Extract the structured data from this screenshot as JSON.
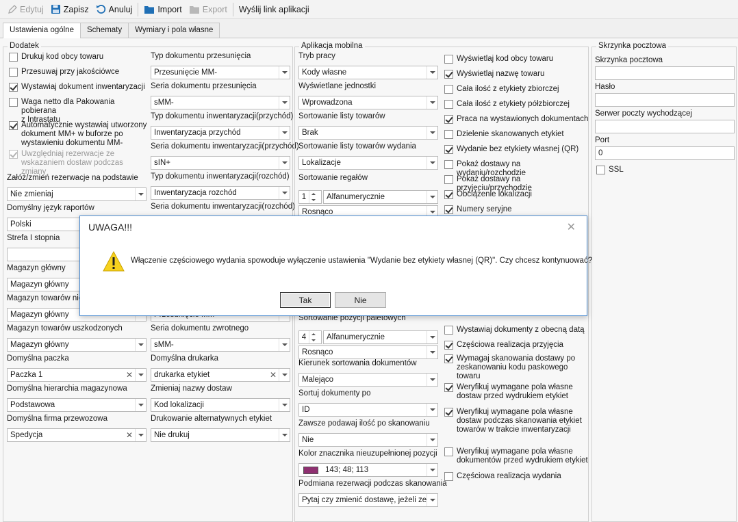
{
  "toolbar": {
    "edit": "Edytuj",
    "save": "Zapisz",
    "cancel": "Anuluj",
    "import": "Import",
    "export": "Export",
    "send_link": "Wyślij link aplikacji"
  },
  "tabs": [
    "Ustawienia ogólne",
    "Schematy",
    "Wymiary i pola własne"
  ],
  "dodatek": {
    "title": "Dodatek",
    "checkboxes": [
      {
        "label": "Drukuj kod obcy towaru",
        "checked": false
      },
      {
        "label": "Przesuwaj przy jakościówce",
        "checked": false
      },
      {
        "label": "Wystawiaj dokument inwentaryzacji",
        "checked": true
      },
      {
        "label": "Waga netto dla Pakowania pobierana\nz Intrastatu",
        "checked": false
      },
      {
        "label": "Automatycznie wystawiaj utworzony\ndokument MM+ w buforze po\nwystawieniu dokumentu MM-",
        "checked": true
      },
      {
        "label": "Uwzględniaj rezerwacje ze\nwskazaniem dostaw podczas zmiany",
        "checked": true
      }
    ],
    "left_fields": [
      {
        "label": "Załóż/zmień rezerwacje na podstawie",
        "value": "Nie zmieniaj"
      },
      {
        "label": "Domyślny język raportów",
        "value": "Polski"
      },
      {
        "label": "Strefa I stopnia",
        "value": ""
      },
      {
        "label": "Magazyn główny",
        "value": "Magazyn główny"
      },
      {
        "label": "Magazyn towarów nie",
        "value": "Magazyn główny"
      },
      {
        "label": "Magazyn towarów uszkodzonych",
        "value": "Magazyn główny"
      },
      {
        "label": "Domyślna paczka",
        "value": "Paczka 1"
      },
      {
        "label": "Domyślna hierarchia magazynowa",
        "value": "Podstawowa"
      },
      {
        "label": "Domyślna firma przewozowa",
        "value": "Spedycja"
      }
    ],
    "right_fields": [
      {
        "label": "Typ dokumentu przesunięcia",
        "value": "Przesunięcie MM-"
      },
      {
        "label": "Seria dokumentu przesunięcia",
        "value": "sMM-"
      },
      {
        "label": "Typ dokumentu inwentaryzacji(przychód)",
        "value": "Inwentaryzacja przychód"
      },
      {
        "label": "Seria dokumentu inwentaryzacji(przychód)",
        "value": "sIN+"
      },
      {
        "label": "Typ dokumentu inwentaryzacji(rozchód)",
        "value": "Inwentaryzacja rozchód"
      },
      {
        "label": "Seria dokumentu inwentaryzacji(rozchód)",
        "value": ""
      },
      {
        "label": "",
        "value": "Przesunięcie MM-"
      },
      {
        "label": "Seria dokumentu zwrotnego",
        "value": "sMM-"
      },
      {
        "label": "Domyślna drukarka",
        "value": "drukarka etykiet"
      },
      {
        "label": "Zmieniaj nazwy dostaw",
        "value": "Kod lokalizacji"
      },
      {
        "label": "Drukowanie alternatywnych etykiet",
        "value": "Nie drukuj"
      }
    ]
  },
  "mobile": {
    "title": "Aplikacja mobilna",
    "fields_top": [
      {
        "label": "Tryb pracy",
        "value": "Kody własne"
      },
      {
        "label": "Wyświetlane jednostki",
        "value": "Wprowadzona"
      },
      {
        "label": "Sortowanie listy towarów",
        "value": "Brak"
      },
      {
        "label": "Sortowanie listy towarów wydania",
        "value": "Lokalizacje"
      }
    ],
    "regaly": {
      "label": "Sortowanie regałów",
      "num": "1",
      "value": "Alfanumerycznie",
      "order": "Rosnąco"
    },
    "paletowe": {
      "label": "Sortowanie pozycji paletowych",
      "num": "4",
      "value": "Alfanumerycznie",
      "order": "Rosnąco"
    },
    "fields_bottom": [
      {
        "label": "Kierunek sortowania dokumentów",
        "value": "Malejąco"
      },
      {
        "label": "Sortuj dokumenty po",
        "value": "ID"
      },
      {
        "label": "Zawsze podawaj ilość po skanowaniu",
        "value": "Nie"
      }
    ],
    "color": {
      "label": "Kolor znacznika nieuzupełnionej pozycji",
      "value": "143; 48; 113",
      "hex": "#8f3071"
    },
    "podmiana": {
      "label": "Podmiana rezerwacji podczas skanowania",
      "value": "Pytaj czy zmienić dostawę, jeżeli ze..."
    },
    "checks_top": [
      {
        "label": "Wyświetlaj kod obcy towaru",
        "checked": false
      },
      {
        "label": "Wyświetlaj nazwę towaru",
        "checked": true
      },
      {
        "label": "Cała ilość z etykiety zbiorczej",
        "checked": false
      },
      {
        "label": "Cała ilość z etykiety półzbiorczej",
        "checked": false
      },
      {
        "label": "Praca na wystawionych dokumentach",
        "checked": true
      },
      {
        "label": "Dzielenie skanowanych etykiet",
        "checked": false
      },
      {
        "label": "Wydanie bez etykiety własnej (QR)",
        "checked": true
      },
      {
        "label": "Pokaż dostawy na wydaniu/rozchodzie",
        "checked": false
      },
      {
        "label": "Pokaż dostawy na przyjęciu/przychodzie",
        "checked": false
      },
      {
        "label": "Obciążenie lokalizacji",
        "checked": true
      },
      {
        "label": "Numery seryjne",
        "checked": true
      }
    ],
    "checks_bottom": [
      {
        "label": "Wystawiaj dokumenty z obecną datą",
        "checked": false
      },
      {
        "label": "Częściowa realizacja przyjęcia",
        "checked": true
      },
      {
        "label": "Wymagaj skanowania dostawy po\nzeskanowaniu kodu paskowego\ntowaru",
        "checked": true
      },
      {
        "label": "Weryfikuj wymagane pola własne\ndostaw przed wydrukiem etykiet",
        "checked": true
      },
      {
        "label": "Weryfikuj wymagane pola własne\ndostaw podczas skanowania etykiet\ntowarów w trakcie inwentaryzacji",
        "checked": true
      },
      {
        "label": "Weryfikuj wymagane pola własne\ndokumentów przed wydrukiem etykiet",
        "checked": false
      },
      {
        "label": "Częściowa realizacja wydania",
        "checked": false
      }
    ]
  },
  "mailbox": {
    "title": "Skrzynka pocztowa",
    "fields": [
      {
        "label": "Skrzynka pocztowa",
        "value": ""
      },
      {
        "label": "Hasło",
        "value": ""
      },
      {
        "label": "Serwer poczty wychodzącej",
        "value": ""
      },
      {
        "label": "Port",
        "value": "0"
      }
    ],
    "ssl": {
      "label": "SSL",
      "checked": false
    }
  },
  "dialog": {
    "title": "UWAGA!!!",
    "message": "Włączenie częściowego wydania spowoduje wyłączenie ustawienia \"Wydanie bez etykiety własnej (QR)\". Czy chcesz kontynuować?",
    "yes": "Tak",
    "no": "Nie",
    "close": "✕"
  }
}
